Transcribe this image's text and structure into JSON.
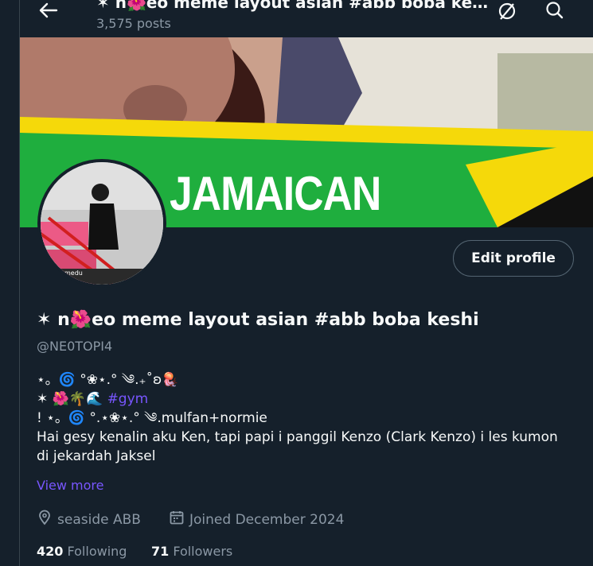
{
  "header": {
    "title": "✶ n🌺eo meme layout asian #abb boba keshi",
    "posts": "3,575 posts"
  },
  "icons": {
    "back": "back-arrow-icon",
    "grok": "grok-icon",
    "search": "search-icon",
    "location": "location-icon",
    "calendar": "calendar-icon"
  },
  "banner": {
    "text": "JAMAICAN"
  },
  "avatar": {
    "caption": "medu"
  },
  "actions": {
    "edit_profile": "Edit profile"
  },
  "profile": {
    "name": "✶ n🌺eo meme layout asian #abb boba keshi",
    "handle": "@NE0TOPI4",
    "bio": {
      "line1": "⋆。🌀 °❀⋆.° ༄.₊˚ʚ🪼",
      "line2_prefix": "✶ 🌺🌴🌊 ",
      "line2_hashtag": "#gym",
      "line3": "! ⋆。🌀 °.⋆❀⋆.° ༄.mulfan+normie",
      "line4": "Hai gesy kenalin aku Ken, tapi papi i panggil Kenzo (Clark Kenzo) i les kumon di jekardah Jaksel"
    },
    "view_more": "View more",
    "location": "seaside ABB",
    "joined": "Joined December 2024",
    "following_count": "420",
    "following_label": "Following",
    "followers_count": "71",
    "followers_label": "Followers"
  },
  "colors": {
    "background": "#15202b",
    "text": "#f7f9f9",
    "muted": "#8b98a5",
    "accent": "#7856ff",
    "border": "#38444d"
  }
}
